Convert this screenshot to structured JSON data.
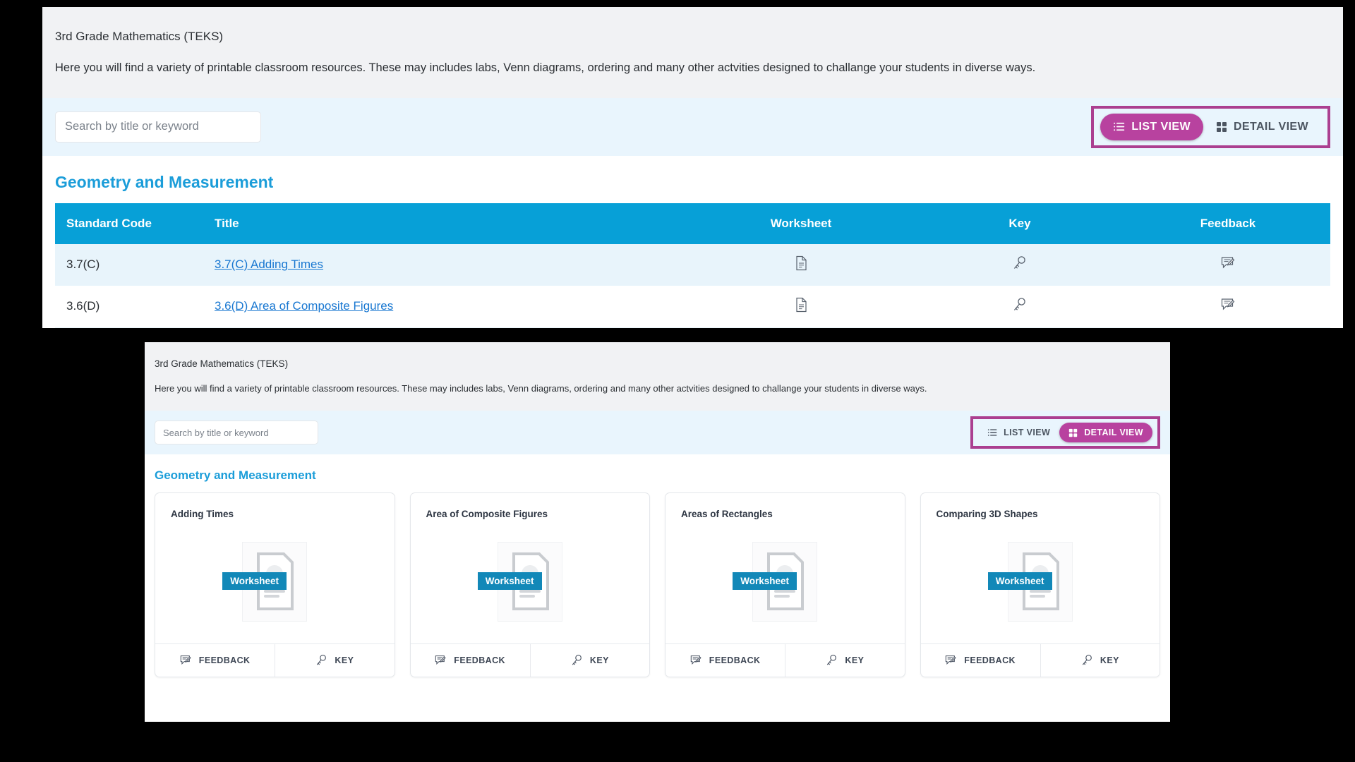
{
  "panel_list": {
    "description": {
      "title": "3rd Grade Mathematics (TEKS)",
      "text": "Here you will find a variety of printable classroom resources. These may includes labs, Venn diagrams, ordering and many other actvities designed to challange your students in diverse ways."
    },
    "search": {
      "placeholder": "Search by title or keyword",
      "value": ""
    },
    "view_switch": {
      "list_label": "LIST VIEW",
      "detail_label": "DETAIL VIEW",
      "active": "list",
      "list_icon": "list-icon",
      "detail_icon": "grid-icon",
      "highlight_color": "#ab3f90",
      "active_color": "#b8429f"
    },
    "section_heading": "Geometry and Measurement",
    "table": {
      "columns": [
        "Standard Code",
        "Title",
        "Worksheet",
        "Key",
        "Feedback"
      ],
      "rows": [
        {
          "standard_code": "3.7(C)",
          "title": "3.7(C) Adding Times",
          "worksheet_icon": "document-icon",
          "key_icon": "key-icon",
          "feedback_icon": "feedback-icon"
        },
        {
          "standard_code": "3.6(D)",
          "title": "3.6(D) Area of Composite Figures",
          "worksheet_icon": "document-icon",
          "key_icon": "key-icon",
          "feedback_icon": "feedback-icon"
        }
      ]
    }
  },
  "panel_detail": {
    "description": {
      "title": "3rd Grade Mathematics (TEKS)",
      "text": "Here you will find a variety of printable classroom resources. These may includes labs, Venn diagrams, ordering and many other actvities designed to challange your students in diverse ways."
    },
    "search": {
      "placeholder": "Search by title or keyword",
      "value": ""
    },
    "view_switch": {
      "list_label": "LIST VIEW",
      "detail_label": "DETAIL VIEW",
      "active": "detail",
      "list_icon": "list-icon",
      "detail_icon": "grid-icon",
      "highlight_color": "#ab3f90",
      "active_color": "#b8429f"
    },
    "section_heading": "Geometry and Measurement",
    "cards": [
      {
        "title": "Adding Times",
        "badge": "Worksheet",
        "thumb_icon": "document-placeholder-icon",
        "feedback_label": "FEEDBACK",
        "key_label": "KEY"
      },
      {
        "title": "Area of Composite Figures",
        "badge": "Worksheet",
        "thumb_icon": "document-placeholder-icon",
        "feedback_label": "FEEDBACK",
        "key_label": "KEY"
      },
      {
        "title": "Areas of Rectangles",
        "badge": "Worksheet",
        "thumb_icon": "document-placeholder-icon",
        "feedback_label": "FEEDBACK",
        "key_label": "KEY"
      },
      {
        "title": "Comparing 3D Shapes",
        "badge": "Worksheet",
        "thumb_icon": "document-placeholder-icon",
        "feedback_label": "FEEDBACK",
        "key_label": "KEY"
      }
    ]
  },
  "colors": {
    "table_header": "#07a0d7",
    "section_heading": "#1b9dd9",
    "link": "#1877d1",
    "badge": "#1288b8",
    "magenta": "#b8429f",
    "toolbar_bg": "#e9f5fd",
    "desc_bg": "#f1f2f4"
  }
}
